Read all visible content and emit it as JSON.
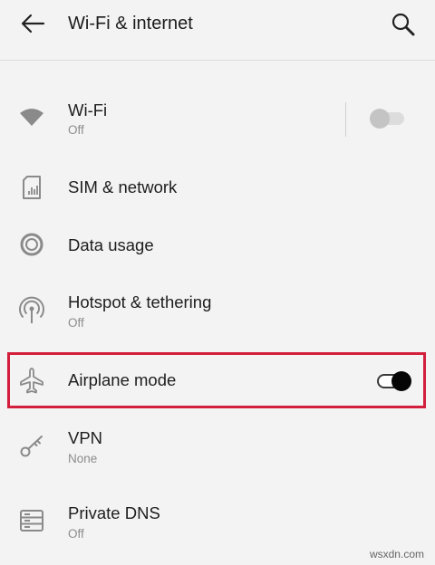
{
  "header": {
    "title": "Wi-Fi & internet"
  },
  "items": [
    {
      "label": "Wi-Fi",
      "subtitle": "Off",
      "icon": "wifi-icon",
      "toggle": "off"
    },
    {
      "label": "SIM & network",
      "icon": "sim-card-icon"
    },
    {
      "label": "Data usage",
      "icon": "data-usage-icon"
    },
    {
      "label": "Hotspot & tethering",
      "subtitle": "Off",
      "icon": "hotspot-icon"
    },
    {
      "label": "Airplane mode",
      "icon": "airplane-icon",
      "toggle": "on"
    },
    {
      "label": "VPN",
      "subtitle": "None",
      "icon": "key-icon"
    },
    {
      "label": "Private DNS",
      "subtitle": "Off",
      "icon": "dns-icon"
    }
  ],
  "colors": {
    "highlight": "#d21f3c",
    "background": "#f3f3f3",
    "icon": "#8a8a8a"
  },
  "watermark": "wsxdn.com"
}
